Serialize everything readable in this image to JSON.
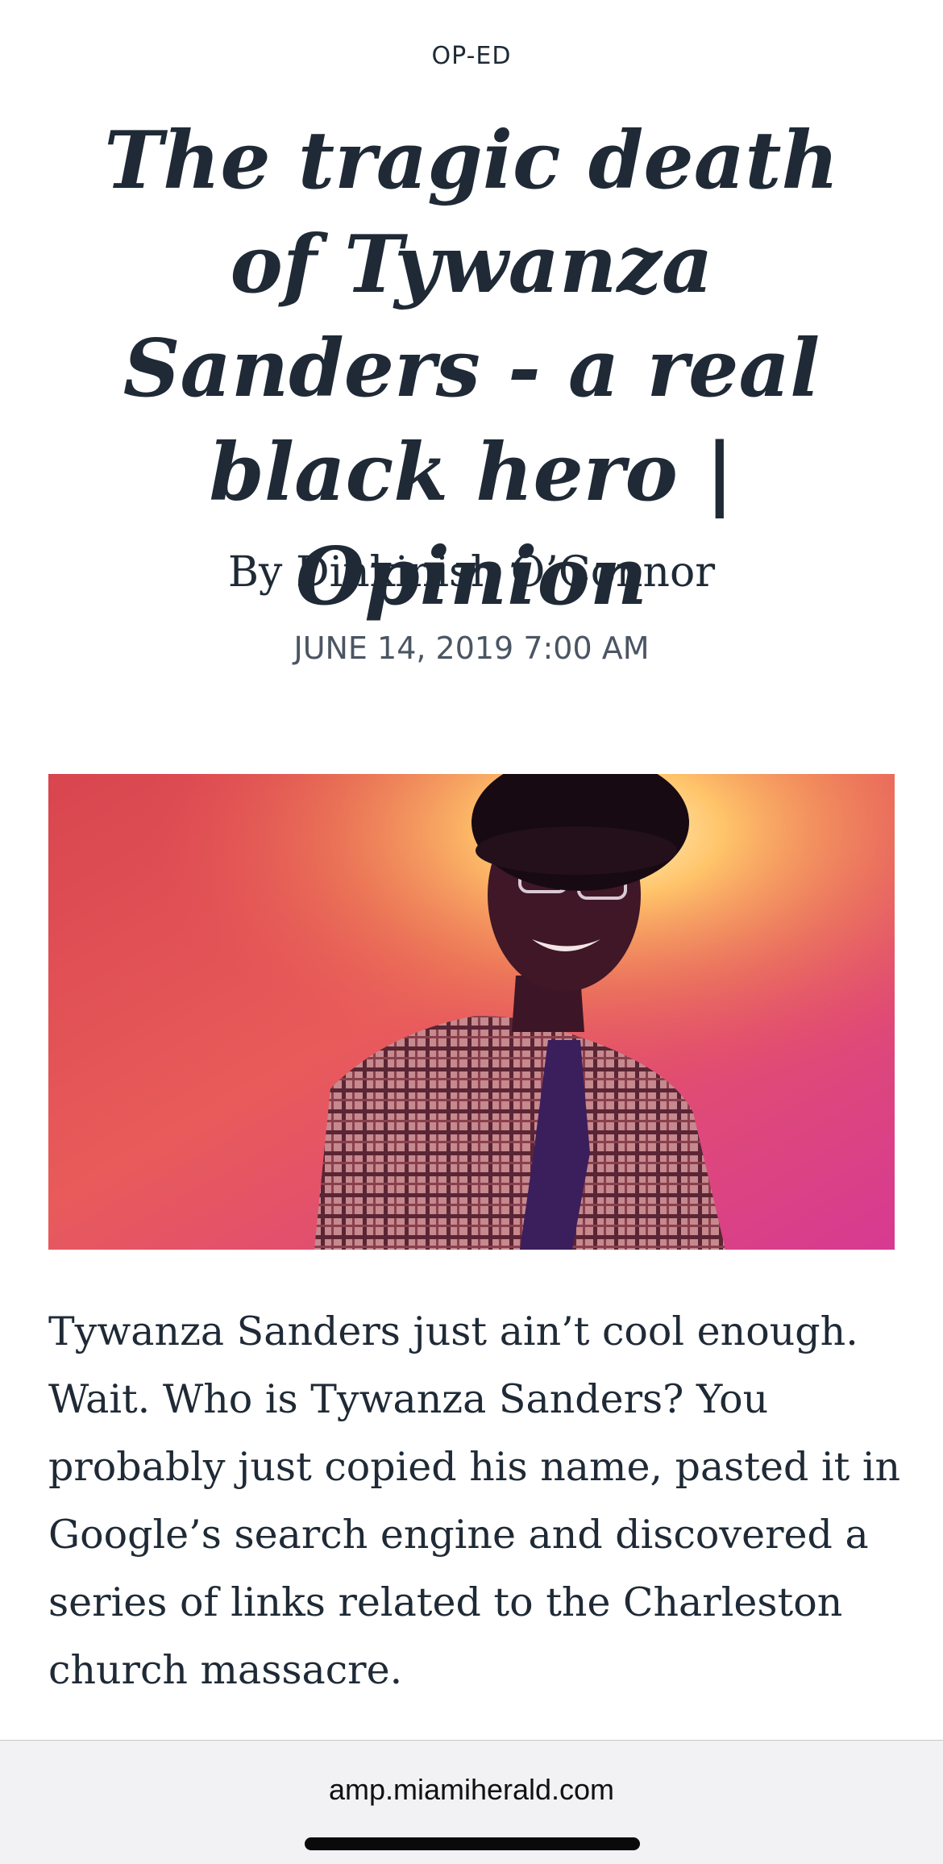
{
  "article": {
    "section": "OP-ED",
    "headline": "The tragic death of Tywanza Sanders - a real black hero | Opinion",
    "byline": "By Dinkinish O’Connor",
    "dateline": "JUNE 14, 2019 7:00 AM",
    "body": "Tywanza Sanders just ain’t cool enough. Wait. Who is Tywanza Sanders? You probably just copied his name, pasted it in Google’s search engine and discovered a series of links related to the Charleston church massacre."
  },
  "browser": {
    "url": "amp.miamiherald.com"
  },
  "colors": {
    "text": "#1f2a36",
    "dateline": "#4b5563",
    "toolbar": "#f2f2f4"
  }
}
